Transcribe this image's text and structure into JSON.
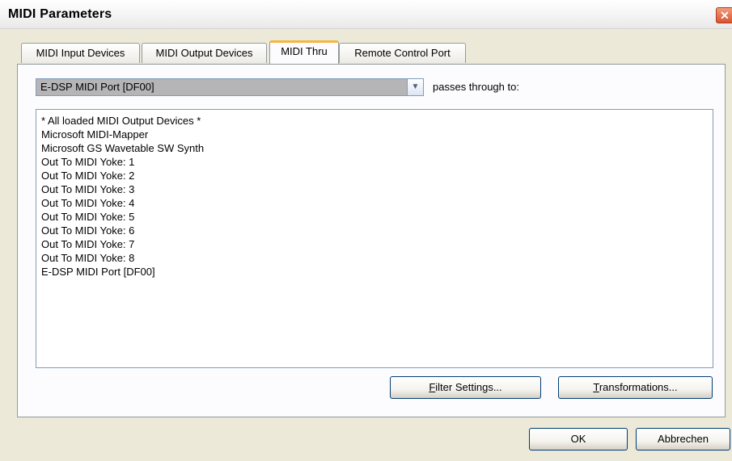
{
  "window": {
    "title": "MIDI Parameters",
    "close_glyph": "✕"
  },
  "tabs": [
    {
      "label": "MIDI Input Devices",
      "active": false
    },
    {
      "label": "MIDI Output Devices",
      "active": false
    },
    {
      "label": "MIDI Thru",
      "active": true
    },
    {
      "label": "Remote Control Port",
      "active": false
    }
  ],
  "thru": {
    "source_device": "E-DSP MIDI Port [DF00]",
    "passes_label": "passes through to:",
    "destinations": [
      "* All loaded MIDI Output Devices *",
      "Microsoft MIDI-Mapper",
      "Microsoft GS Wavetable SW Synth",
      "Out To MIDI Yoke:  1",
      "Out To MIDI Yoke:  2",
      "Out To MIDI Yoke:  3",
      "Out To MIDI Yoke:  4",
      "Out To MIDI Yoke:  5",
      "Out To MIDI Yoke:  6",
      "Out To MIDI Yoke:  7",
      "Out To MIDI Yoke:  8",
      "E-DSP MIDI Port [DF00]"
    ],
    "filter_button": {
      "accel": "F",
      "rest": "ilter Settings..."
    },
    "transform_button": {
      "accel": "T",
      "rest": "ransformations..."
    }
  },
  "footer": {
    "ok_label": "OK",
    "cancel_label": "Abbrechen"
  },
  "icons": {
    "close": "close-icon",
    "dropdown": "chevron-down-icon"
  },
  "colors": {
    "dialog_bg": "#ece9d8",
    "active_tab_accent": "#f5b540",
    "close_button": "#d9532f"
  }
}
